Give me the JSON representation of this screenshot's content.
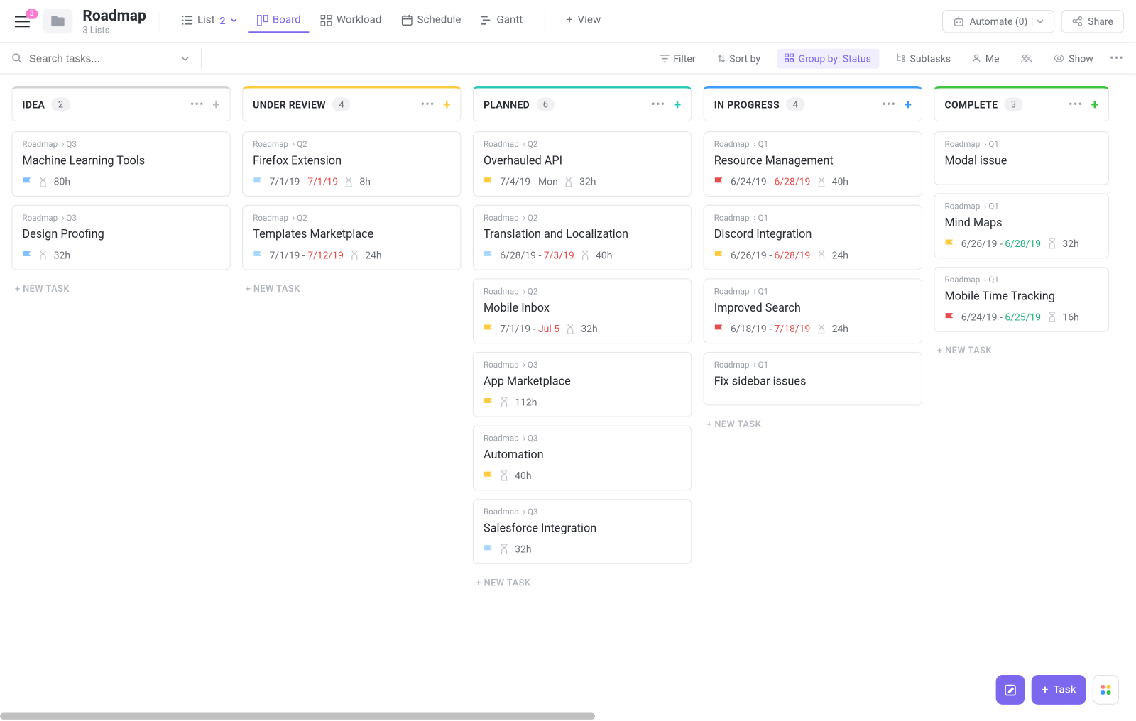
{
  "header": {
    "notif_badge": "3",
    "title": "Roadmap",
    "subtitle": "3 Lists",
    "views": [
      {
        "icon": "list",
        "label": "List",
        "count": "2",
        "chev": true
      },
      {
        "icon": "board",
        "label": "Board",
        "active": true
      },
      {
        "icon": "workload",
        "label": "Workload"
      },
      {
        "icon": "schedule",
        "label": "Schedule"
      },
      {
        "icon": "gantt",
        "label": "Gantt"
      }
    ],
    "add_view": "View",
    "automate": "Automate (0)",
    "share": "Share"
  },
  "toolbar": {
    "search_placeholder": "Search tasks...",
    "filter": "Filter",
    "sort": "Sort by",
    "group": "Group by: Status",
    "subtasks": "Subtasks",
    "me": "Me",
    "show": "Show"
  },
  "new_task_label": "+ NEW TASK",
  "columns": [
    {
      "name": "IDEA",
      "count": "2",
      "accent": "#d2d4d8",
      "plus_color": "#b8bbc1",
      "cards": [
        {
          "crumb": [
            "Roadmap",
            "Q3"
          ],
          "title": "Machine Learning Tools",
          "flag": "f-blue",
          "hours": "80h"
        },
        {
          "crumb": [
            "Roadmap",
            "Q3"
          ],
          "title": "Design Proofing",
          "flag": "f-blue",
          "hours": "32h"
        }
      ]
    },
    {
      "name": "UNDER REVIEW",
      "count": "4",
      "accent": "#ffc93c",
      "plus_color": "#ffc93c",
      "cards": [
        {
          "crumb": [
            "Roadmap",
            "Q2"
          ],
          "title": "Firefox Extension",
          "flag": "f-lblue",
          "date1": "7/1/19",
          "date2": "7/1/19",
          "date2_cls": "d-red",
          "hours": "8h"
        },
        {
          "crumb": [
            "Roadmap",
            "Q2"
          ],
          "title": "Templates Marketplace",
          "flag": "f-lblue",
          "date1": "7/1/19",
          "date2": "7/12/19",
          "date2_cls": "d-red",
          "hours": "24h"
        }
      ]
    },
    {
      "name": "PLANNED",
      "count": "6",
      "accent": "#28c8b8",
      "plus_color": "#28c8b8",
      "cards": [
        {
          "crumb": [
            "Roadmap",
            "Q2"
          ],
          "title": "Overhauled API",
          "flag": "f-yellow",
          "date1": "7/4/19",
          "date2": "Mon",
          "hours": "32h"
        },
        {
          "crumb": [
            "Roadmap",
            "Q2"
          ],
          "title": "Translation and Localization",
          "flag": "f-lblue",
          "date1": "6/28/19",
          "date2": "7/3/19",
          "date2_cls": "d-red",
          "hours": "40h"
        },
        {
          "crumb": [
            "Roadmap",
            "Q2"
          ],
          "title": "Mobile Inbox",
          "flag": "f-yellow",
          "date1": "7/1/19",
          "date2": "Jul 5",
          "date2_cls": "d-red",
          "hours": "32h"
        },
        {
          "crumb": [
            "Roadmap",
            "Q3"
          ],
          "title": "App Marketplace",
          "flag": "f-yellow",
          "hours": "112h"
        },
        {
          "crumb": [
            "Roadmap",
            "Q3"
          ],
          "title": "Automation",
          "flag": "f-yellow",
          "hours": "40h"
        },
        {
          "crumb": [
            "Roadmap",
            "Q3"
          ],
          "title": "Salesforce Integration",
          "flag": "f-lblue",
          "hours": "32h"
        }
      ]
    },
    {
      "name": "IN PROGRESS",
      "count": "4",
      "accent": "#3a9bff",
      "plus_color": "#3a9bff",
      "cards": [
        {
          "crumb": [
            "Roadmap",
            "Q1"
          ],
          "title": "Resource Management",
          "flag": "f-red",
          "date1": "6/24/19",
          "date2": "6/28/19",
          "date2_cls": "d-red",
          "hours": "40h"
        },
        {
          "crumb": [
            "Roadmap",
            "Q1"
          ],
          "title": "Discord Integration",
          "flag": "f-yellow",
          "date1": "6/26/19",
          "date2": "6/28/19",
          "date2_cls": "d-red",
          "hours": "24h"
        },
        {
          "crumb": [
            "Roadmap",
            "Q1"
          ],
          "title": "Improved Search",
          "flag": "f-red",
          "date1": "6/18/19",
          "date2": "7/18/19",
          "date2_cls": "d-red",
          "hours": "24h"
        },
        {
          "crumb": [
            "Roadmap",
            "Q1"
          ],
          "title": "Fix sidebar issues"
        }
      ]
    },
    {
      "name": "COMPLETE",
      "count": "3",
      "accent": "#3cc23c",
      "plus_color": "#3cc23c",
      "cut": true,
      "cards": [
        {
          "crumb": [
            "Roadmap",
            "Q1"
          ],
          "title": "Modal issue"
        },
        {
          "crumb": [
            "Roadmap",
            "Q1"
          ],
          "title": "Mind Maps",
          "flag": "f-yellow",
          "date1": "6/26/19",
          "date2": "6/28/19",
          "date2_cls": "d-green",
          "hours": "32h"
        },
        {
          "crumb": [
            "Roadmap",
            "Q1"
          ],
          "title": "Mobile Time Tracking",
          "flag": "f-red",
          "date1": "6/24/19",
          "date2": "6/25/19",
          "date2_cls": "d-green",
          "hours": "16h"
        }
      ]
    }
  ],
  "fab": {
    "task": "Task"
  }
}
